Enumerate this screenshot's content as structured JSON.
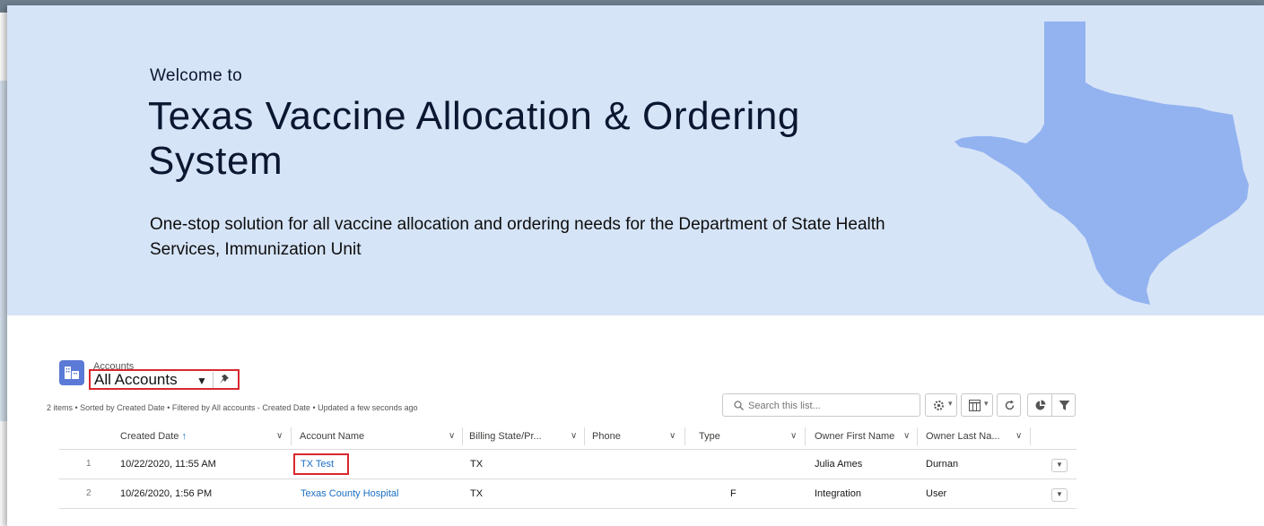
{
  "hero": {
    "welcome": "Welcome to",
    "title": "Texas Vaccine Allocation & Ordering System",
    "subtitle": "One-stop solution for all vaccine allocation and ordering needs for the Department of State Health Services, Immunization Unit"
  },
  "list_view": {
    "object_label": "Accounts",
    "list_name": "All Accounts",
    "meta": "2 items • Sorted by Created Date • Filtered by All accounts - Created Date • Updated a few seconds ago",
    "search_placeholder": "Search this list..."
  },
  "toolbar": {
    "icons": [
      "settings-icon",
      "display-as-table-icon",
      "refresh-icon",
      "chart-icon",
      "filter-icon"
    ]
  },
  "table": {
    "columns": [
      "Created Date",
      "Account Name",
      "Billing State/Pr...",
      "Phone",
      "Type",
      "Owner First Name",
      "Owner Last Na..."
    ],
    "sort_indicator": "↑",
    "rows": [
      {
        "num": "1",
        "created": "10/22/2020, 11:55 AM",
        "account": "TX Test",
        "state": "TX",
        "phone": "",
        "type": "",
        "owner_first": "Julia Ames",
        "owner_last": "Durnan"
      },
      {
        "num": "2",
        "created": "10/26/2020, 1:56 PM",
        "account": "Texas County Hospital",
        "state": "TX",
        "phone": "",
        "type": "F",
        "owner_first": "Integration",
        "owner_last": "User"
      }
    ]
  },
  "colors": {
    "hero_bg": "#d6e4f7",
    "map_fill": "#93b2f0",
    "title": "#0b1630",
    "link": "#1a6ec2",
    "highlight": "#d9272e",
    "object_icon": "#5b79d6"
  }
}
